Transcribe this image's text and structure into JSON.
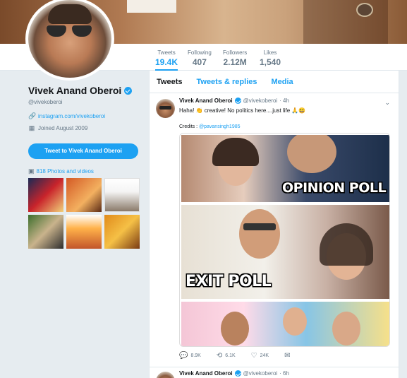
{
  "profile": {
    "name": "Vivek Anand Oberoi",
    "handle": "@vivekoberoi",
    "website": "instagram.com/vivekoberoi",
    "joined": "Joined August 2009",
    "tweet_to_label": "Tweet to Vivek Anand Oberoi",
    "photos_label": "818 Photos and videos"
  },
  "stats": [
    {
      "label": "Tweets",
      "value": "19.4K"
    },
    {
      "label": "Following",
      "value": "407"
    },
    {
      "label": "Followers",
      "value": "2.12M"
    },
    {
      "label": "Likes",
      "value": "1,540"
    }
  ],
  "tabs": [
    {
      "label": "Tweets"
    },
    {
      "label": "Tweets & replies"
    },
    {
      "label": "Media"
    }
  ],
  "tweet": {
    "name": "Vivek Anand Oberoi",
    "handle": "@vivekoberoi",
    "time": "· 4h",
    "text": "Haha! 👏 creative! No politics here....just life 🙏😃",
    "credits_prefix": "Credits : ",
    "credits_link": "@pavansingh1985",
    "image_text_1": "OPINION POLL",
    "image_text_2": "EXIT POLL",
    "replies": "8.9K",
    "retweets": "6.1K",
    "likes": "24K"
  },
  "tweet2": {
    "name": "Vivek Anand Oberoi",
    "handle": "@vivekoberoi",
    "time": "· 6h"
  },
  "colors": {
    "accent": "#1da1f2",
    "background": "#e6ecf0",
    "text": "#14171a",
    "muted": "#657786"
  },
  "icons": {
    "link": "link-icon",
    "calendar": "calendar-icon",
    "photo": "photo-icon",
    "verified": "verified-badge-icon",
    "chevron": "chevron-down-icon",
    "reply": "reply-icon",
    "retweet": "retweet-icon",
    "like": "heart-icon",
    "message": "envelope-icon"
  }
}
